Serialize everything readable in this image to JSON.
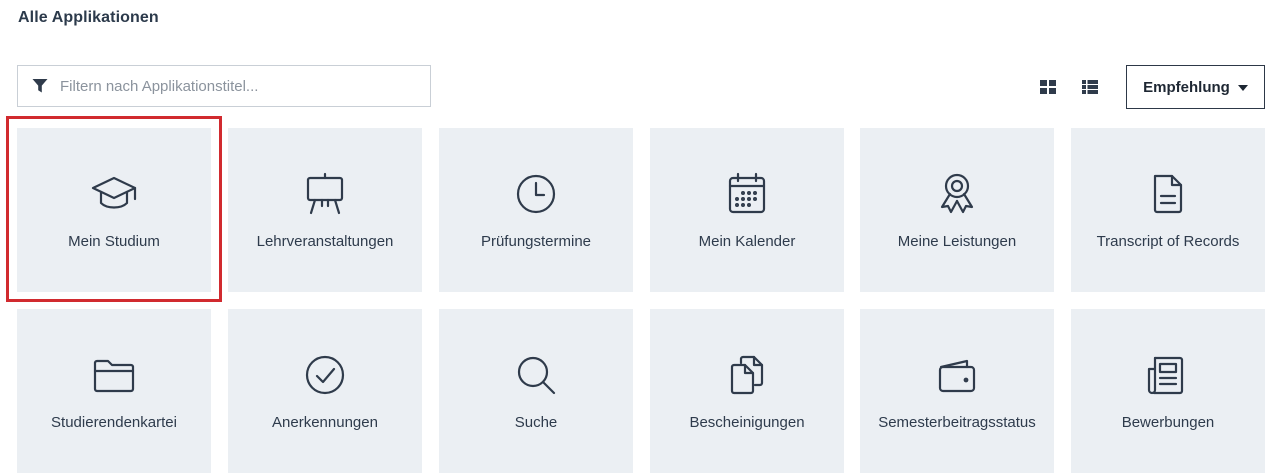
{
  "page": {
    "title": "Alle Applikationen"
  },
  "filter": {
    "placeholder": "Filtern nach Applikationstitel...",
    "value": "",
    "icon": "filter-icon"
  },
  "view_options": {
    "grid_icon": "grid-view-icon",
    "list_icon": "list-view-icon"
  },
  "sort": {
    "label": "Empfehlung"
  },
  "highlight_color": "#d12a2f",
  "tile_background": "#ebeff3",
  "apps": [
    {
      "label": "Mein Studium",
      "icon": "graduation-cap-icon",
      "highlighted": true
    },
    {
      "label": "Lehrveranstaltungen",
      "icon": "easel-icon",
      "highlighted": false
    },
    {
      "label": "Prüfungstermine",
      "icon": "clock-icon",
      "highlighted": false
    },
    {
      "label": "Mein Kalender",
      "icon": "calendar-icon",
      "highlighted": false
    },
    {
      "label": "Meine Leistungen",
      "icon": "award-icon",
      "highlighted": false
    },
    {
      "label": "Transcript of Records",
      "icon": "document-icon",
      "highlighted": false
    },
    {
      "label": "Studierendenkartei",
      "icon": "folder-icon",
      "highlighted": false
    },
    {
      "label": "Anerkennungen",
      "icon": "check-circle-icon",
      "highlighted": false
    },
    {
      "label": "Suche",
      "icon": "search-icon",
      "highlighted": false
    },
    {
      "label": "Bescheinigungen",
      "icon": "copy-documents-icon",
      "highlighted": false
    },
    {
      "label": "Semesterbeitragsstatus",
      "icon": "wallet-icon",
      "highlighted": false
    },
    {
      "label": "Bewerbungen",
      "icon": "newspaper-icon",
      "highlighted": false
    }
  ]
}
